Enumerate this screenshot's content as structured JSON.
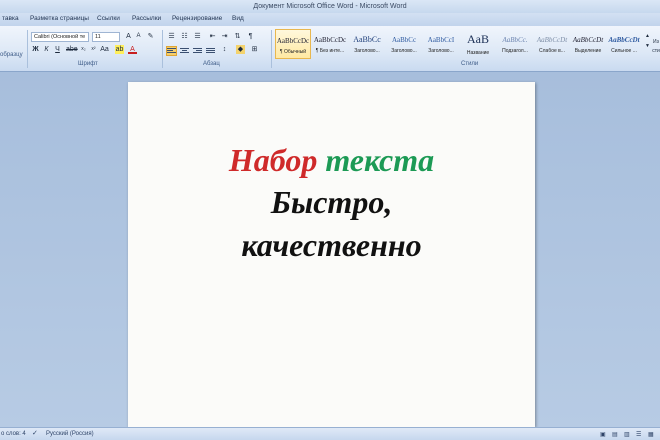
{
  "window": {
    "title": "Документ Microsoft Office Word - Microsoft Word"
  },
  "tabs": [
    "тавка",
    "Разметка страницы",
    "Ссылки",
    "Рассылки",
    "Рецензирование",
    "Вид"
  ],
  "ribbon": {
    "font_name": "Calibri (Основной те",
    "font_size": "11",
    "left_caption": "образцу",
    "groups": {
      "font": "Шрифт",
      "paragraph": "Абзац",
      "styles": "Стили"
    },
    "styles": [
      {
        "sample": "AaBbCcDc",
        "name": "¶ Обычный",
        "active": true
      },
      {
        "sample": "AaBbCcDc",
        "name": "¶ Без инте...",
        "active": false
      },
      {
        "sample": "AaBbCc",
        "name": "Заголово...",
        "active": false
      },
      {
        "sample": "AaBbCc",
        "name": "Заголово...",
        "active": false
      },
      {
        "sample": "AaBbCcI",
        "name": "Заголово...",
        "active": false
      },
      {
        "sample": "AaB",
        "name": "Название",
        "active": false
      },
      {
        "sample": "AaBbCc.",
        "name": "Подзагол...",
        "active": false
      },
      {
        "sample": "AaBbCcDt",
        "name": "Слабое в...",
        "active": false
      },
      {
        "sample": "AaBbCcDt",
        "name": "Выделение",
        "active": false
      },
      {
        "sample": "AaBbCcDt",
        "name": "Сильное ...",
        "active": false
      }
    ],
    "right_fragment": "Из\nсти"
  },
  "document": {
    "line1_word1": "Набор",
    "line1_word2": "текста",
    "line2": "Быстро,",
    "line3": "качественно"
  },
  "status": {
    "words": "о слов: 4",
    "language": "Русский (Россия)"
  },
  "colors": {
    "red": "#cf2a2a",
    "green": "#1c9a55",
    "accent": "#e8b74f"
  }
}
